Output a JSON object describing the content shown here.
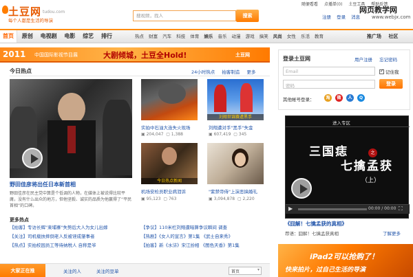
{
  "header": {
    "logo": "土豆网",
    "domain": "tudou.com",
    "slogan": "每个人都是生活的导演",
    "search_placeholder": "搜视频，找人",
    "search_button": "搜索",
    "top_links": [
      "随便看看",
      "点播单(0)",
      "土豆工具",
      "帮助反馈"
    ],
    "auth_links": [
      "注册",
      "登录",
      "消息"
    ],
    "watermark_title": "网页教学网",
    "watermark_url": "www.webjx.com"
  },
  "nav": {
    "main": [
      "首页",
      "原创",
      "电视剧",
      "电影",
      "综艺",
      "排行"
    ],
    "active": "首页",
    "sub": [
      {
        "label": "热点",
        "bold": false
      },
      {
        "label": "财富",
        "bold": false
      },
      {
        "label": "汽车",
        "bold": false
      },
      {
        "label": "科技",
        "bold": false
      },
      {
        "label": "体育",
        "bold": false
      },
      {
        "label": "娱乐",
        "bold": true
      },
      {
        "label": "音乐",
        "bold": false
      },
      {
        "label": "动漫",
        "bold": false
      },
      {
        "label": "游戏",
        "bold": false
      },
      {
        "label": "搞笑",
        "bold": false
      },
      {
        "label": "风尚",
        "bold": true
      },
      {
        "label": "女性",
        "bold": false
      },
      {
        "label": "乐活",
        "bold": false
      },
      {
        "label": "教育",
        "bold": false
      }
    ],
    "right": [
      "推广场",
      "社区"
    ]
  },
  "banner": {
    "year": "2011",
    "festival": "中国国际影视节目展",
    "slogan": "大剧倾城，土豆全Hold!",
    "brand": "土豆网"
  },
  "hot": {
    "title": "今日热点",
    "links": [
      "24小时热点",
      "拍客制造",
      "更多"
    ],
    "headline": "野田佳彦将出任日本新首相",
    "desc": "野田佳彦在民主党中算是个低调的人物，在媒体上被说得比较平庸，没有什么出众的地方，但他坚毅、诚实的品质为他赢得了“平民首相”的口碑。"
  },
  "thumbs": [
    {
      "caption": "实拍中石油大连失火现场",
      "label": "",
      "views": "204,047",
      "comments": "1,388"
    },
    {
      "caption": "刘翔遭对手\"黑手\"失金",
      "label": "刘翔世锦赛遭黑手",
      "views": "607,419",
      "comments": "345"
    },
    {
      "caption": "机场安检员职业病泪诉",
      "label": "今日热点新闻",
      "views": "95,123",
      "comments": "763"
    },
    {
      "caption": "\"紫禁帝侍\"上演恶搞婚礼",
      "label": "",
      "views": "3,094,878",
      "comments": "2,220"
    }
  ],
  "more_news": {
    "title": "更多热点",
    "left": [
      "【拍客】专访长辉\"柬埔寨\"失势后大人为女儿出嫁",
      "【关注】司机载扶摔倒老人反被诬成肇事者",
      "【热点】实拍校园员工等待纳税人 自称是爷"
    ],
    "right": [
      "【争议】110米栏刘翔遭暗算争议瞬间 调查",
      "【热剧】《女人的宣言》第1集 《武士自来秀》",
      "【拍客】新《水浒》宋江扮相 《图色天香》第1集"
    ]
  },
  "bottom": {
    "tab": "大家正在推",
    "links": [
      "关注的人",
      "关注的豆单"
    ],
    "select": "首页"
  },
  "login": {
    "title": "登录土豆网",
    "links": [
      "用户注册",
      "忘记密码"
    ],
    "email_placeholder": "Email",
    "password_placeholder": "密码",
    "remember": "记住我",
    "button": "登录",
    "other_login": "其他帐号登录："
  },
  "video": {
    "zone": "进入专区",
    "title_line1": "三国痣",
    "title_zhi": "之",
    "title_line2": "七擒孟获",
    "title_part": "（上）",
    "time": "00:00 / 00:00",
    "progress": 0,
    "caption": "《囧解！七擒孟获的真相》",
    "sub": "荐语：囧解！七擒孟获真相",
    "more": "了解更多"
  },
  "ad": {
    "line1": "iPad2可以抢购了！",
    "line2": "快来拍片，过自己生活的导演"
  },
  "colors": {
    "accent": "#ff7a00",
    "link": "#2255aa"
  }
}
